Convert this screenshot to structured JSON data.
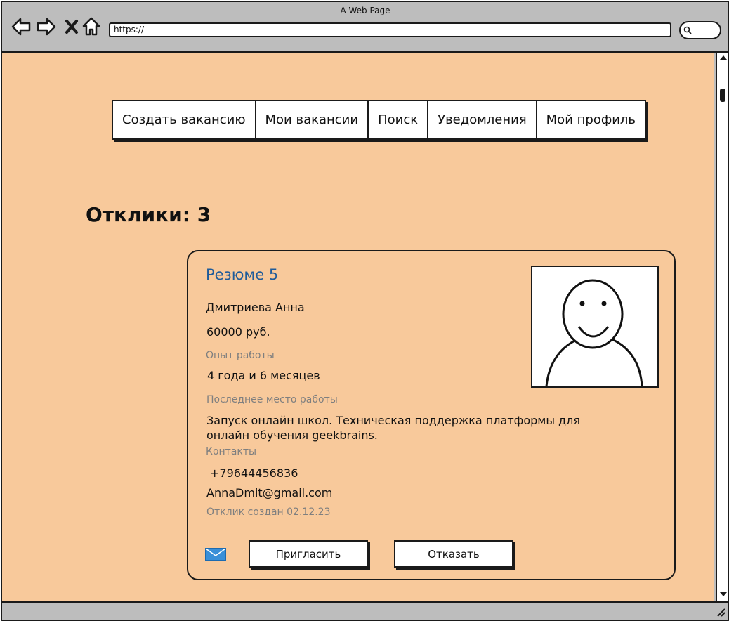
{
  "window": {
    "title": "A Web Page",
    "url": "https://"
  },
  "nav": {
    "items": [
      {
        "label": "Создать вакансию"
      },
      {
        "label": "Мои вакансии"
      },
      {
        "label": "Поиск"
      },
      {
        "label": "Уведомления"
      },
      {
        "label": "Мой профиль"
      }
    ]
  },
  "page": {
    "heading": "Отклики: 3"
  },
  "card": {
    "title": "Резюме 5",
    "name": "Дмитриева Анна",
    "salary": "60000 руб.",
    "experience_label": "Опыт работы",
    "experience": "4 года и 6 месяцев",
    "last_job_label": "Последнее место работы",
    "last_job_line1": "Запуск онлайн школ. Техническая поддержка платформы для",
    "last_job_line2": "онлайн обучения geekbrains.",
    "contacts_label": "Контакты",
    "phone": "+79644456836",
    "email": "AnnaDmit@gmail.com",
    "created": "Отклик создан 02.12.23",
    "invite_label": "Пригласить",
    "decline_label": "Отказать",
    "mail_icon": "envelope-icon",
    "avatar_icon": "person-icon"
  },
  "colors": {
    "background": "#f8c99b",
    "title_link": "#1f5b9a",
    "label": "#7f7f7f",
    "mail_icon": "#3a8fd8"
  }
}
